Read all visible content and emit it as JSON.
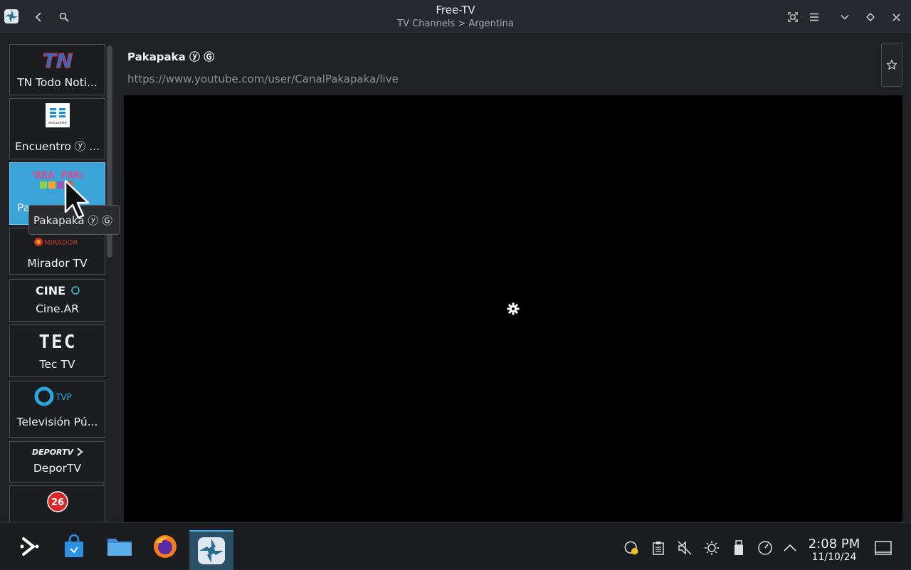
{
  "window": {
    "title": "Free-TV",
    "subtitle": "TV Channels > Argentina"
  },
  "channels": [
    {
      "name": "TN Todo Noti...",
      "logo_text": "TN"
    },
    {
      "name": "Encuentro ⓨ ...",
      "logo_text": "encuentro"
    },
    {
      "name": "Pa",
      "logo_text": "PAKA PAKA",
      "selected": true
    },
    {
      "name": "Mirador TV",
      "logo_text": "MIRADOR"
    },
    {
      "name": "Cine.AR",
      "logo_text": "CINE"
    },
    {
      "name": "Tec TV",
      "logo_text": "TEC"
    },
    {
      "name": "Televisión Pú...",
      "logo_text": "TVP"
    },
    {
      "name": "DeporTV",
      "logo_text": "DEPORTV"
    },
    {
      "name": "",
      "logo_text": "26"
    }
  ],
  "tooltip": {
    "text": "Pakapaka ⓨ Ⓖ"
  },
  "detail": {
    "title": "Pakapaka ⓨ Ⓖ",
    "url": "https://www.youtube.com/user/CanalPakapaka/live"
  },
  "taskbar": {
    "time": "2:08 PM",
    "date": "11/10/24"
  },
  "colors": {
    "accent": "#3daee9",
    "selected_card": "#3aa3d8",
    "background": "#1f2125"
  }
}
